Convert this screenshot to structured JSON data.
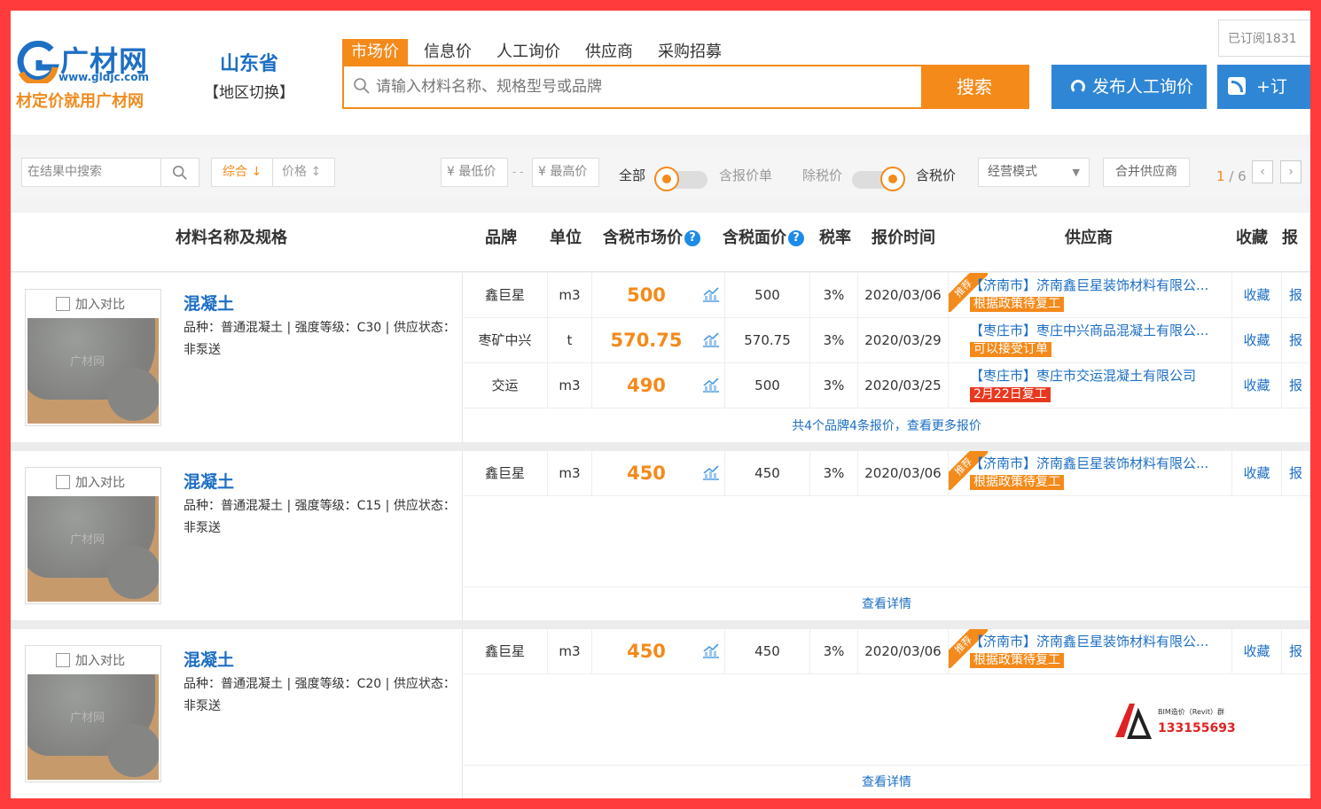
{
  "header": {
    "logo_name": "广材网",
    "logo_url": "www.gldjc.com",
    "logo_slogan": "材定价就用广材网",
    "region_name": "山东省",
    "region_switch": "【地区切换】",
    "subscribed": "已订阅1831",
    "search_tabs": [
      "市场价",
      "信息价",
      "人工询价",
      "供应商",
      "采购招募"
    ],
    "search_placeholder": "请输入材料名称、规格型号或品牌",
    "search_button": "搜索",
    "publish_button": "发布人工询价",
    "subscribe_button": "+订"
  },
  "filters": {
    "result_search_placeholder": "在结果中搜索",
    "sort_combined": "综合 ↓",
    "sort_price": "价格",
    "min_price": "¥ 最低价",
    "price_sep": "- -",
    "max_price": "¥ 最高价",
    "all_label": "全部",
    "with_quote_label": "含报价单",
    "excl_tax_label": "除税价",
    "incl_tax_label": "含税价",
    "mode_select": "经营模式",
    "merge_suppliers": "合并供应商",
    "page_current": "1",
    "page_total": " / 6"
  },
  "table_headers": {
    "name": "材料名称及规格",
    "brand": "品牌",
    "unit": "单位",
    "market_price": "含税市场价",
    "face_price": "含税面价",
    "tax_rate": "税率",
    "quote_time": "报价时间",
    "supplier": "供应商",
    "favorite": "收藏",
    "report": "报"
  },
  "products": [
    {
      "compare": "加入对比",
      "watermark": "广材网",
      "title": "混凝土",
      "spec": "品种：普通混凝土 | 强度等级：C30 | 供应状态：非泵送",
      "quotes": [
        {
          "brand": "鑫巨星",
          "unit": "m3",
          "price": "500",
          "face": "500",
          "tax": "3%",
          "date": "2020/03/06",
          "recommended": true,
          "supplier": "【济南市】济南鑫巨星装饰材料有限公...",
          "tag": "根据政策待复工",
          "fav": "收藏",
          "report": "报"
        },
        {
          "brand": "枣矿中兴",
          "unit": "t",
          "price": "570.75",
          "face": "570.75",
          "tax": "3%",
          "date": "2020/03/29",
          "recommended": false,
          "supplier": "【枣庄市】枣庄中兴商品混凝土有限公...",
          "tag": "可以接受订单",
          "fav": "收藏",
          "report": "报"
        },
        {
          "brand": "交运",
          "unit": "m3",
          "price": "490",
          "face": "500",
          "tax": "3%",
          "date": "2020/03/25",
          "recommended": false,
          "supplier": "【枣庄市】枣庄市交运混凝土有限公司",
          "tag": "2月22日复工",
          "fav": "收藏",
          "report": "报"
        }
      ],
      "more": "共4个品牌4条报价，查看更多报价"
    },
    {
      "compare": "加入对比",
      "watermark": "广材网",
      "title": "混凝土",
      "spec": "品种：普通混凝土 | 强度等级：C15 | 供应状态：非泵送",
      "quotes": [
        {
          "brand": "鑫巨星",
          "unit": "m3",
          "price": "450",
          "face": "450",
          "tax": "3%",
          "date": "2020/03/06",
          "recommended": true,
          "supplier": "【济南市】济南鑫巨星装饰材料有限公...",
          "tag": "根据政策待复工",
          "fav": "收藏",
          "report": "报"
        }
      ],
      "more": "查看详情"
    },
    {
      "compare": "加入对比",
      "watermark": "广材网",
      "title": "混凝土",
      "spec": "品种：普通混凝土 | 强度等级：C20 | 供应状态：非泵送",
      "quotes": [
        {
          "brand": "鑫巨星",
          "unit": "m3",
          "price": "450",
          "face": "450",
          "tax": "3%",
          "date": "2020/03/06",
          "recommended": true,
          "supplier": "【济南市】济南鑫巨星装饰材料有限公...",
          "tag": "根据政策待复工",
          "fav": "收藏",
          "report": "报"
        }
      ],
      "more": "查看详情"
    }
  ],
  "recommended_label": "推荐",
  "bim_mark": {
    "line1": "BIM造价（Revit）群",
    "line2": "133155693"
  },
  "colors": {
    "accent": "#f48a1a",
    "brand_blue": "#1d6fc4",
    "button_blue": "#2f86d4",
    "frame": "#ff3b3b"
  }
}
